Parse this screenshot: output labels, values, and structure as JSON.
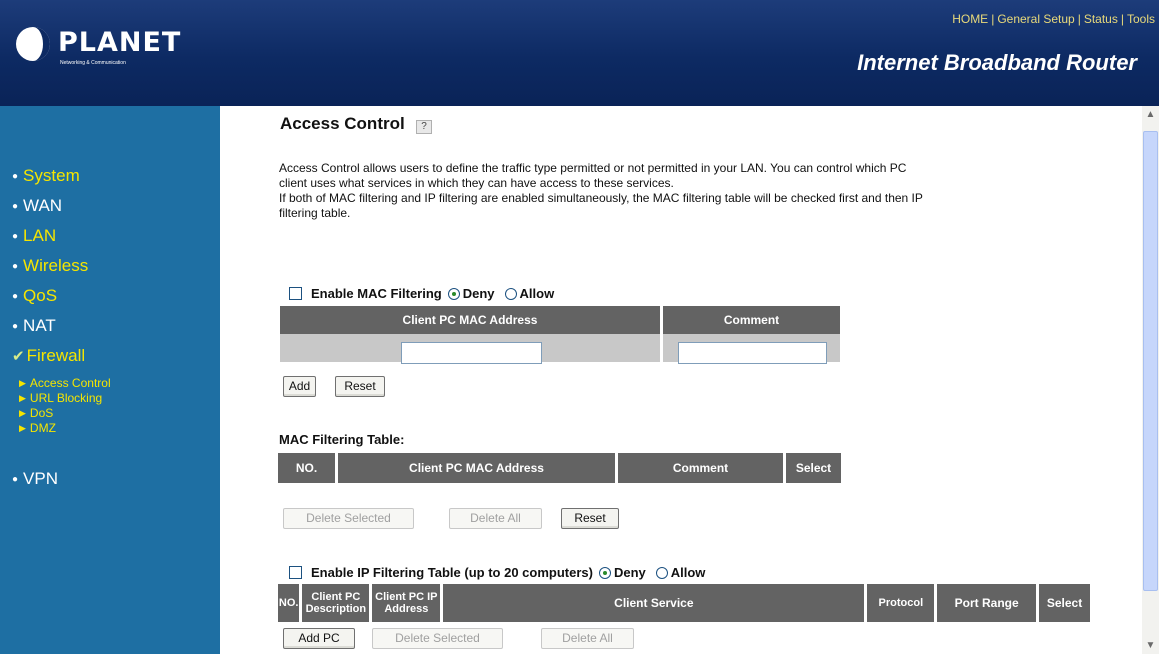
{
  "header": {
    "brand": "PLANET",
    "tagline": "Networking & Communication",
    "nav": [
      "HOME",
      "General Setup",
      "Status",
      "Tools"
    ],
    "router_title": "Internet Broadband Router"
  },
  "sidebar": {
    "items": [
      {
        "label": "System"
      },
      {
        "label": "WAN"
      },
      {
        "label": "LAN"
      },
      {
        "label": "Wireless"
      },
      {
        "label": "QoS"
      },
      {
        "label": "NAT"
      },
      {
        "label": "Firewall"
      },
      {
        "label": "VPN"
      }
    ],
    "firewall_sub": [
      {
        "label": "Access Control"
      },
      {
        "label": "URL Blocking"
      },
      {
        "label": "DoS"
      },
      {
        "label": "DMZ"
      }
    ]
  },
  "main": {
    "title": "Access Control",
    "description_lines": [
      "Access Control allows users to define the traffic type permitted or not permitted in your LAN. You can control which PC",
      "client uses what services in which they can have access to these services.",
      "If both of MAC filtering and IP filtering are enabled simultaneously, the MAC filtering table will be checked first and then IP",
      "filtering table."
    ],
    "mac_filter": {
      "enable_label": "Enable MAC Filtering",
      "deny_label": "Deny",
      "allow_label": "Allow",
      "columns": [
        "Client PC MAC Address",
        "Comment"
      ],
      "add_label": "Add",
      "reset_label": "Reset"
    },
    "mac_table": {
      "title": "MAC Filtering Table:",
      "columns": [
        "NO.",
        "Client PC MAC Address",
        "Comment",
        "Select"
      ],
      "delete_selected_label": "Delete Selected",
      "delete_all_label": "Delete All",
      "reset_label": "Reset"
    },
    "ip_filter": {
      "enable_label": "Enable IP Filtering Table (up to 20 computers)",
      "deny_label": "Deny",
      "allow_label": "Allow",
      "columns": [
        "NO.",
        "Client PC Description",
        "Client PC IP Address",
        "Client Service",
        "Protocol",
        "Port Range",
        "Select"
      ],
      "add_pc_label": "Add PC",
      "delete_selected_label": "Delete Selected",
      "delete_all_label": "Delete All"
    }
  },
  "colors": {
    "header": "#0d2a63",
    "sidebar": "#1e6fa3",
    "nav_text": "#f5e500",
    "table_header": "#636363"
  }
}
